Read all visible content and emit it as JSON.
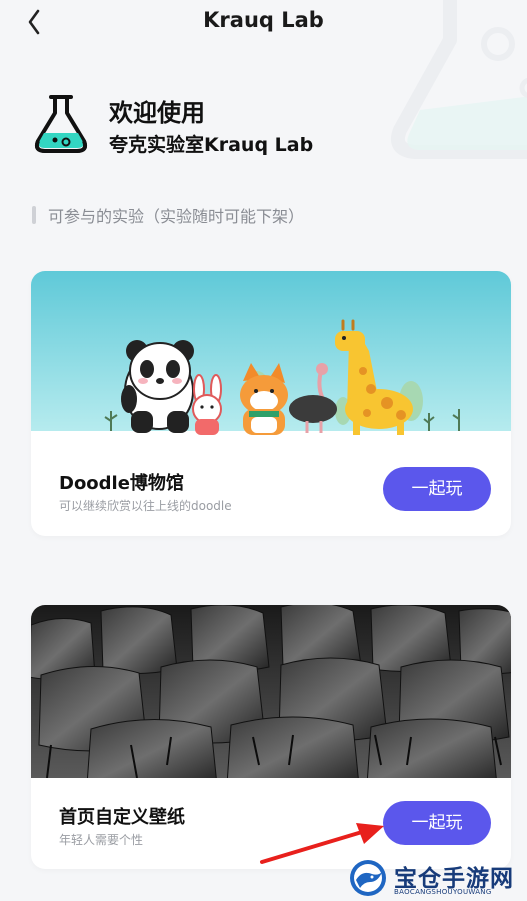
{
  "header": {
    "title": "Krauq Lab"
  },
  "welcome": {
    "title": "欢迎使用",
    "subtitle": "夸克实验室Krauq Lab"
  },
  "section": {
    "label": "可参与的实验（实验随时可能下架）"
  },
  "experiments": [
    {
      "name": "Doodle博物馆",
      "desc": "可以继续欣赏以往上线的doodle",
      "button": "一起玩"
    },
    {
      "name": "首页自定义壁纸",
      "desc": "年轻人需要个性",
      "button": "一起玩"
    }
  ],
  "watermark": {
    "name": "宝仓手游网",
    "sub": "BAOCANGSHOUYOUWANG"
  },
  "colors": {
    "accent": "#5b57ec",
    "teal": "#33d6c2",
    "annotation_arrow": "#e8201c",
    "card_bg": "#ffffff",
    "page_bg": "#f5f6f8"
  },
  "icons": [
    "back-chevron-icon",
    "flask-icon",
    "background-flask-icon",
    "annotation-arrow"
  ]
}
